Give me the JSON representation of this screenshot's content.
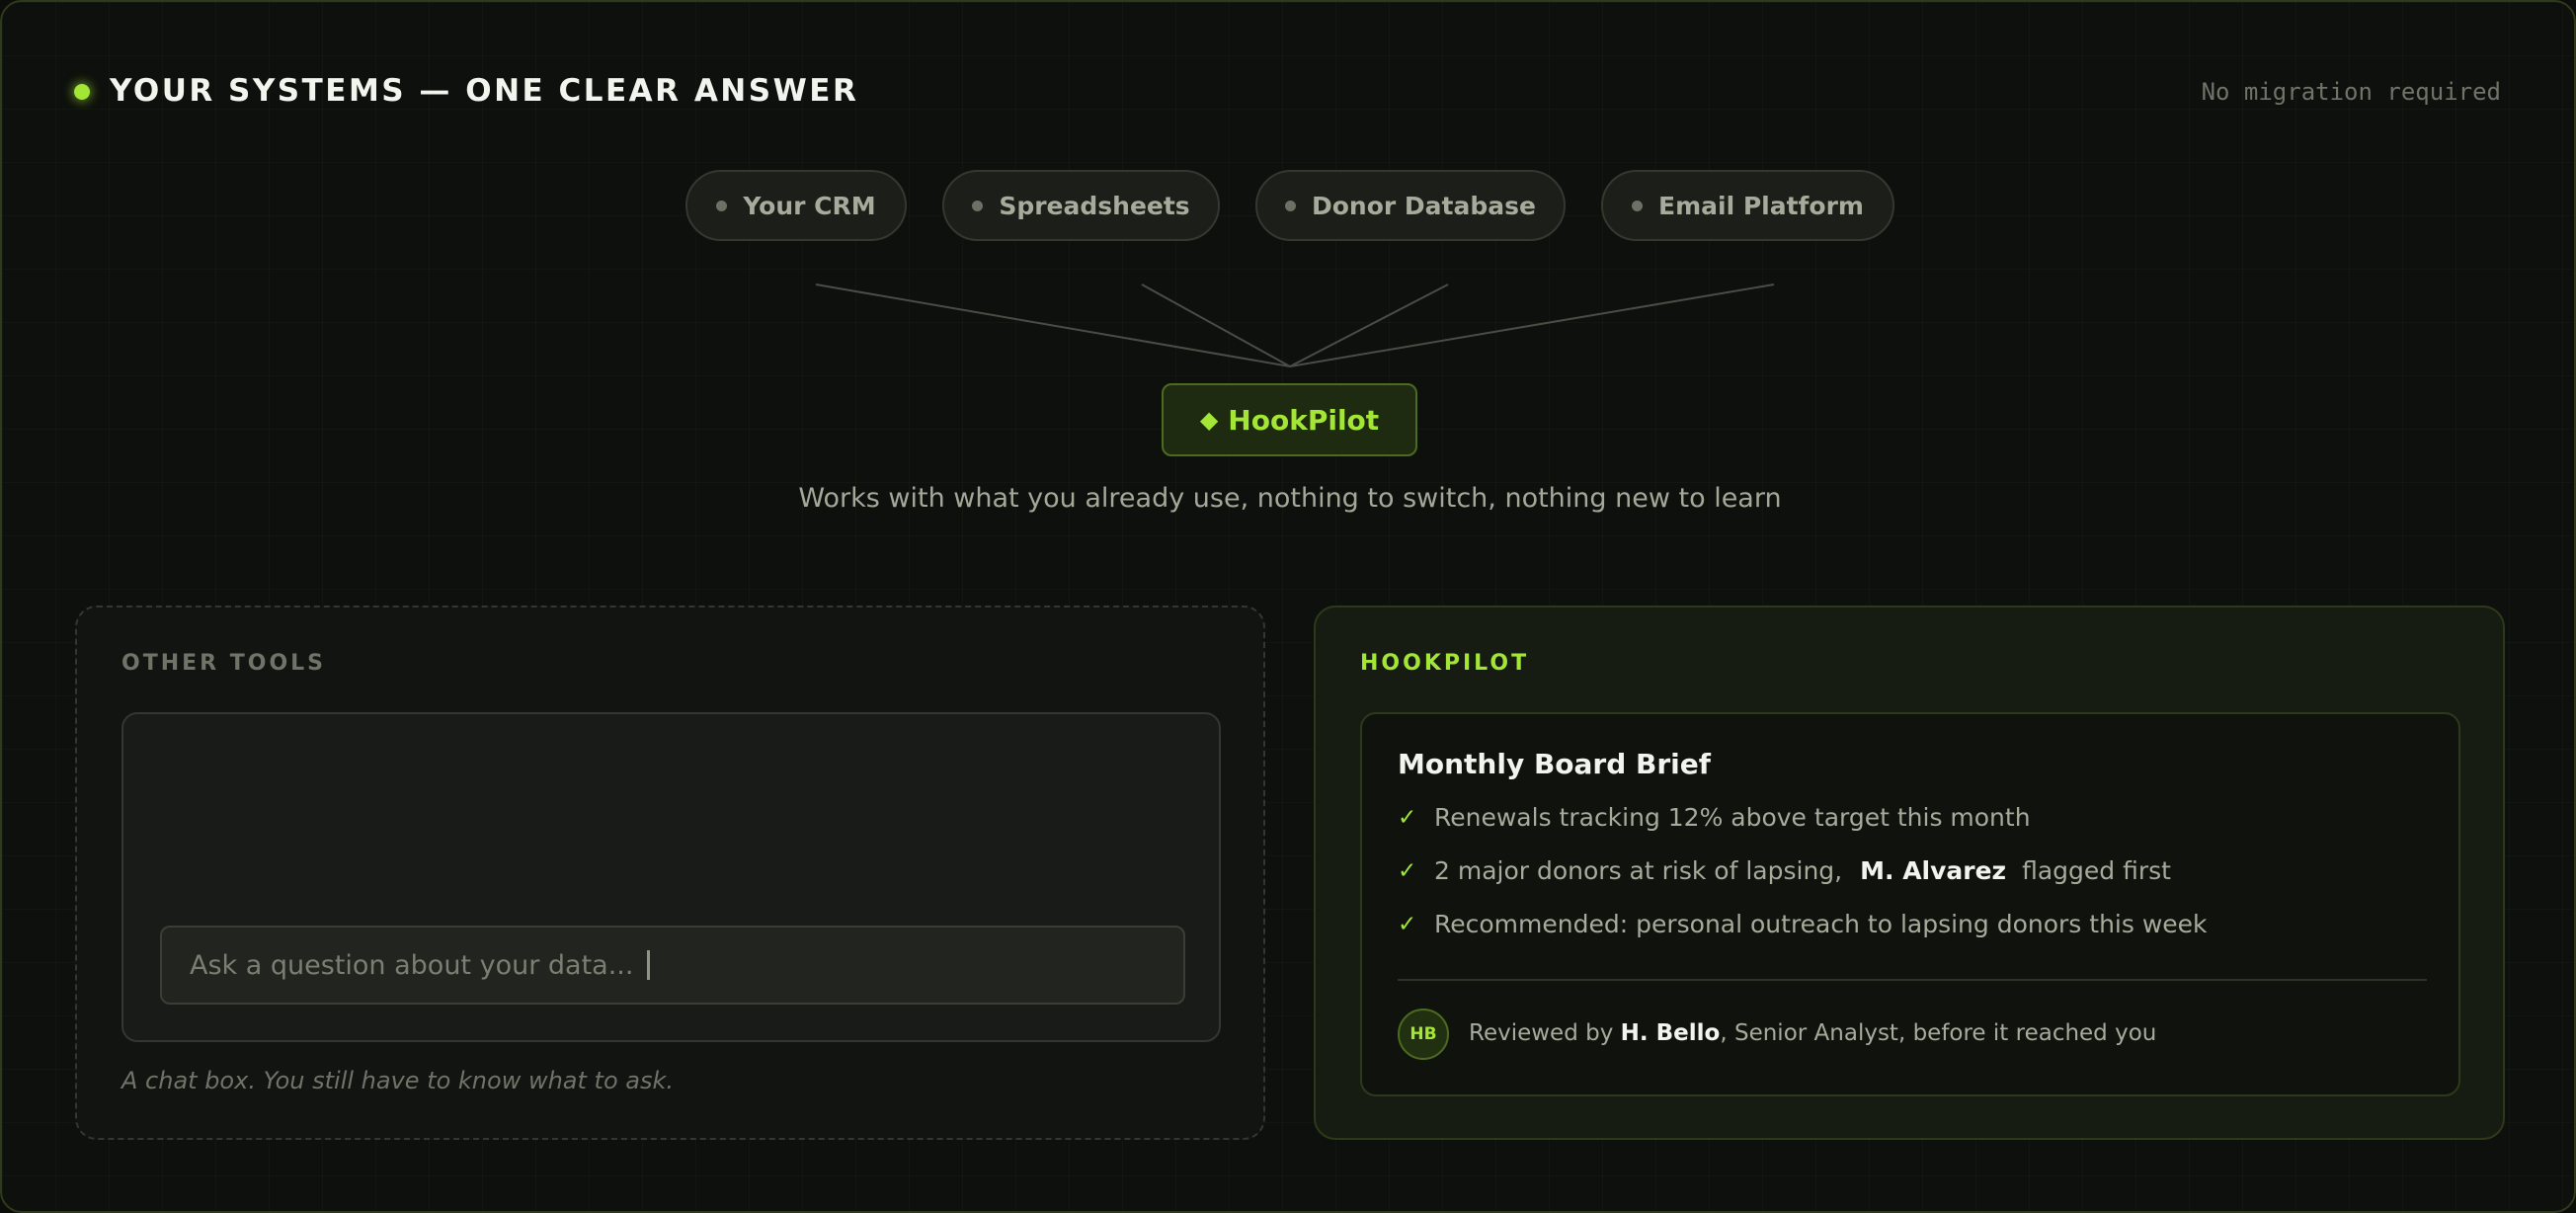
{
  "header": {
    "title": "YOUR SYSTEMS — ONE CLEAR ANSWER",
    "note": "No migration required",
    "accent_color": "#a3e635"
  },
  "sources": [
    {
      "label": "Your CRM"
    },
    {
      "label": "Spreadsheets"
    },
    {
      "label": "Donor Database"
    },
    {
      "label": "Email Platform"
    }
  ],
  "hub": {
    "icon": "diamond-icon",
    "glyph": "◆",
    "label": "HookPilot"
  },
  "tagline": "Works with what you already use, nothing to switch, nothing new to learn",
  "other_tools": {
    "label": "OTHER TOOLS",
    "input_placeholder": "Ask a question about your data...",
    "caption": "A chat box. You still have to know what to ask."
  },
  "hookpilot": {
    "label": "HOOKPILOT",
    "brief": {
      "title": "Monthly Board Brief",
      "check_glyph": "✓",
      "items": [
        {
          "text": "Renewals tracking 12% above target this month"
        },
        {
          "pre": "2 major donors at risk of lapsing,",
          "strong": "M. Alvarez",
          "post": "flagged first"
        },
        {
          "text": "Recommended: personal outreach to lapsing donors this week"
        }
      ],
      "reviewer": {
        "initials": "HB",
        "prefix": "Reviewed by ",
        "name": "H. Bello",
        "suffix": ", Senior Analyst, before it reached you"
      }
    }
  }
}
